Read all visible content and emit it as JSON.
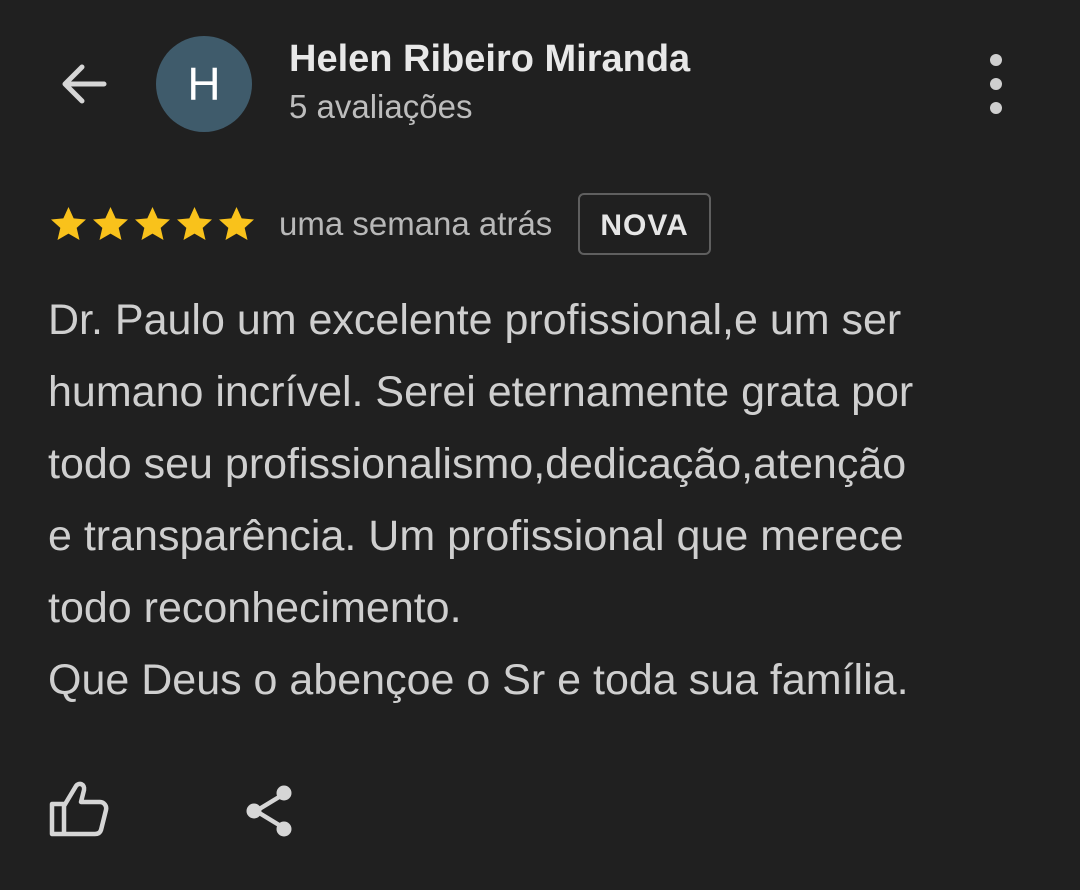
{
  "header": {
    "back_icon": "arrow-left-icon",
    "avatar_initial": "H",
    "author_name": "Helen Ribeiro Miranda",
    "review_count": "5 avaliações",
    "more_icon": "more-vertical-icon"
  },
  "review": {
    "rating": 5,
    "rating_max": 5,
    "date": "uma semana atrás",
    "badge": "NOVA",
    "text": "Dr. Paulo um excelente profissional,e um ser\nhumano incrível. Serei eternamente grata por\ntodo seu profissionalismo,dedicação,atenção\ne transparência. Um profissional que merece\ntodo reconhecimento.\nQue Deus o abençoe o Sr e toda sua família."
  },
  "actions": {
    "like_icon": "thumbs-up-icon",
    "share_icon": "share-icon"
  },
  "colors": {
    "background": "#202020",
    "star": "#f9c21b",
    "avatar": "#3f5b6b"
  }
}
